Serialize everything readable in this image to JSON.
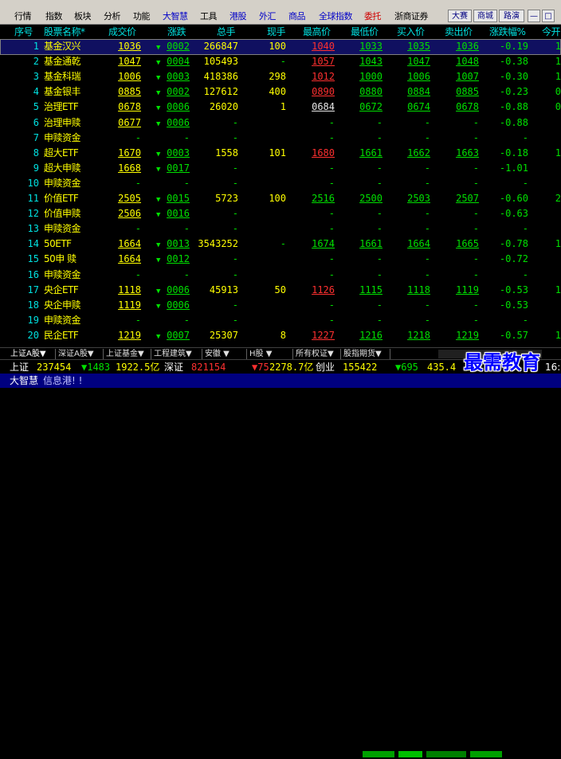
{
  "menu": {
    "items": [
      {
        "label": "行情",
        "color": "black"
      },
      {
        "label": "指数",
        "color": "black"
      },
      {
        "label": "板块",
        "color": "black"
      },
      {
        "label": "分析",
        "color": "black"
      },
      {
        "label": "功能",
        "color": "black"
      },
      {
        "label": "大智慧",
        "color": "blue"
      },
      {
        "label": "工具",
        "color": "black"
      },
      {
        "label": "港股",
        "color": "blue"
      },
      {
        "label": "外汇",
        "color": "blue"
      },
      {
        "label": "商品",
        "color": "blue"
      },
      {
        "label": "全球指数",
        "color": "blue"
      },
      {
        "label": "委托",
        "color": "red"
      },
      {
        "label": "浙商证券",
        "color": "black"
      }
    ],
    "right_buttons": [
      "大赛",
      "商城",
      "路演",
      "—",
      "□"
    ]
  },
  "columns": [
    "序号",
    "股票名称*",
    "成交价",
    "涨跌",
    "总手",
    "现手",
    "最高价",
    "最低价",
    "买入价",
    "卖出价",
    "涨跌幅%",
    "今开"
  ],
  "rows": [
    {
      "idx": "1",
      "name": "基金汉兴",
      "price": "1036",
      "chg": "0002",
      "dir": "down",
      "vol": "266847",
      "cur": "100",
      "high": "1040",
      "high_c": "red",
      "low": "1033",
      "bid": "1035",
      "ask": "1036",
      "pct": "-0.19",
      "open": "1"
    },
    {
      "idx": "2",
      "name": "基金通乾",
      "price": "1047",
      "chg": "0004",
      "dir": "down",
      "vol": "105493",
      "cur": "-",
      "high": "1057",
      "high_c": "red",
      "low": "1043",
      "bid": "1047",
      "ask": "1048",
      "pct": "-0.38",
      "open": "1"
    },
    {
      "idx": "3",
      "name": "基金科瑞",
      "price": "1006",
      "chg": "0003",
      "dir": "down",
      "vol": "418386",
      "cur": "298",
      "high": "1012",
      "high_c": "red",
      "low": "1000",
      "bid": "1006",
      "ask": "1007",
      "pct": "-0.30",
      "open": "1"
    },
    {
      "idx": "4",
      "name": "基金银丰",
      "price": "0885",
      "chg": "0002",
      "dir": "down",
      "vol": "127612",
      "cur": "400",
      "high": "0890",
      "high_c": "red",
      "low": "0880",
      "bid": "0884",
      "ask": "0885",
      "pct": "-0.23",
      "open": "0"
    },
    {
      "idx": "5",
      "name": "治理ETF",
      "price": "0678",
      "chg": "0006",
      "dir": "down",
      "vol": "26020",
      "cur": "1",
      "high": "0684",
      "high_c": "white",
      "low": "0672",
      "bid": "0674",
      "ask": "0678",
      "pct": "-0.88",
      "open": "0"
    },
    {
      "idx": "6",
      "name": "治理申赎",
      "price": "0677",
      "chg": "0006",
      "dir": "down",
      "vol": "-",
      "cur": "",
      "high": "-",
      "high_c": "green",
      "low": "-",
      "bid": "-",
      "ask": "-",
      "pct": "-0.88",
      "open": ""
    },
    {
      "idx": "7",
      "name": "申赎资金",
      "price": "-",
      "chg": "-",
      "dir": "none",
      "vol": "-",
      "cur": "",
      "high": "-",
      "high_c": "green",
      "low": "-",
      "bid": "-",
      "ask": "-",
      "pct": "-",
      "open": ""
    },
    {
      "idx": "8",
      "name": "超大ETF",
      "price": "1670",
      "chg": "0003",
      "dir": "down",
      "vol": "1558",
      "cur": "101",
      "high": "1680",
      "high_c": "red",
      "low": "1661",
      "bid": "1662",
      "ask": "1663",
      "pct": "-0.18",
      "open": "1"
    },
    {
      "idx": "9",
      "name": "超大申赎",
      "price": "1668",
      "chg": "0017",
      "dir": "down",
      "vol": "-",
      "cur": "",
      "high": "-",
      "high_c": "green",
      "low": "-",
      "bid": "-",
      "ask": "-",
      "pct": "-1.01",
      "open": ""
    },
    {
      "idx": "10",
      "name": "申赎资金",
      "price": "-",
      "chg": "-",
      "dir": "none",
      "vol": "-",
      "cur": "",
      "high": "-",
      "high_c": "green",
      "low": "-",
      "bid": "-",
      "ask": "-",
      "pct": "-",
      "open": ""
    },
    {
      "idx": "11",
      "name": "价值ETF",
      "price": "2505",
      "chg": "0015",
      "dir": "down",
      "vol": "5723",
      "cur": "100",
      "high": "2516",
      "high_c": "green",
      "low": "2500",
      "bid": "2503",
      "ask": "2507",
      "pct": "-0.60",
      "open": "2"
    },
    {
      "idx": "12",
      "name": "价值申赎",
      "price": "2506",
      "chg": "0016",
      "dir": "down",
      "vol": "-",
      "cur": "",
      "high": "-",
      "high_c": "green",
      "low": "-",
      "bid": "-",
      "ask": "-",
      "pct": "-0.63",
      "open": ""
    },
    {
      "idx": "13",
      "name": "申赎资金",
      "price": "-",
      "chg": "-",
      "dir": "none",
      "vol": "-",
      "cur": "",
      "high": "-",
      "high_c": "green",
      "low": "-",
      "bid": "-",
      "ask": "-",
      "pct": "-",
      "open": ""
    },
    {
      "idx": "14",
      "name": "50ETF",
      "price": "1664",
      "chg": "0013",
      "dir": "down",
      "vol": "3543252",
      "cur": "-",
      "high": "1674",
      "high_c": "green",
      "low": "1661",
      "bid": "1664",
      "ask": "1665",
      "pct": "-0.78",
      "open": "1"
    },
    {
      "idx": "15",
      "name": "50申 赎",
      "price": "1664",
      "chg": "0012",
      "dir": "down",
      "vol": "-",
      "cur": "",
      "high": "-",
      "high_c": "green",
      "low": "-",
      "bid": "-",
      "ask": "-",
      "pct": "-0.72",
      "open": ""
    },
    {
      "idx": "16",
      "name": "申赎资金",
      "price": "-",
      "chg": "-",
      "dir": "none",
      "vol": "-",
      "cur": "",
      "high": "-",
      "high_c": "green",
      "low": "-",
      "bid": "-",
      "ask": "-",
      "pct": "-",
      "open": ""
    },
    {
      "idx": "17",
      "name": "央企ETF",
      "price": "1118",
      "chg": "0006",
      "dir": "down",
      "vol": "45913",
      "cur": "50",
      "high": "1126",
      "high_c": "red",
      "low": "1115",
      "bid": "1118",
      "ask": "1119",
      "pct": "-0.53",
      "open": "1"
    },
    {
      "idx": "18",
      "name": "央企申赎",
      "price": "1119",
      "chg": "0006",
      "dir": "down",
      "vol": "-",
      "cur": "",
      "high": "-",
      "high_c": "green",
      "low": "-",
      "bid": "-",
      "ask": "-",
      "pct": "-0.53",
      "open": ""
    },
    {
      "idx": "19",
      "name": "申赎资金",
      "price": "-",
      "chg": "-",
      "dir": "none",
      "vol": "-",
      "cur": "",
      "high": "-",
      "high_c": "green",
      "low": "-",
      "bid": "-",
      "ask": "-",
      "pct": "-",
      "open": ""
    },
    {
      "idx": "20",
      "name": "民企ETF",
      "price": "1219",
      "chg": "0007",
      "dir": "down",
      "vol": "25307",
      "cur": "8",
      "high": "1227",
      "high_c": "red",
      "low": "1216",
      "bid": "1218",
      "ask": "1219",
      "pct": "-0.57",
      "open": "1"
    }
  ],
  "tabs": [
    "上证A股▼",
    "深证A股▼",
    "上证基金▼",
    "工程建筑▼",
    "安徽 ▼",
    "H股 ▼",
    "所有权证▼",
    "股指期货▼"
  ],
  "status1": {
    "sh_label": "上证",
    "sh_val": "237454",
    "sh_chg": "▼1483",
    "sh_amt": "1922.5亿",
    "sz_label": "深证",
    "sz_val": "821154",
    "sz_chg": "▼75",
    "sz_amt": "2278.7亿",
    "cy_label": "创业",
    "cy_val": "155422",
    "cy_chg": "▼695",
    "cy_amt": "435.4",
    "time": "16:"
  },
  "status2": {
    "app": "大智慧",
    "info": "信息港! !"
  },
  "watermark": "最需教育",
  "colors": {
    "up": "#ff3030",
    "down": "#00e000",
    "name": "#ffff00",
    "header": "#00e0e0"
  }
}
